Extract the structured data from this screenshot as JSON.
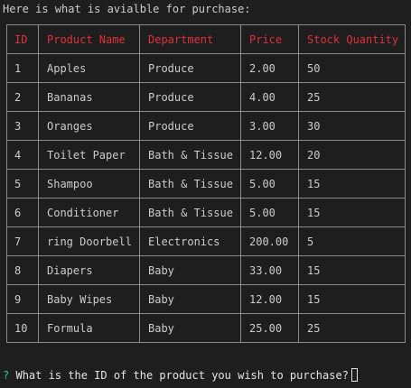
{
  "intro_text": "Here is what is avialble for purchase:",
  "table": {
    "headers": {
      "id": "ID",
      "name": "Product Name",
      "dept": "Department",
      "price": "Price",
      "qty": "Stock Quantity"
    },
    "rows": [
      {
        "id": "1",
        "name": "Apples",
        "dept": "Produce",
        "price": "2.00",
        "qty": "50"
      },
      {
        "id": "2",
        "name": "Bananas",
        "dept": "Produce",
        "price": "4.00",
        "qty": "25"
      },
      {
        "id": "3",
        "name": "Oranges",
        "dept": "Produce",
        "price": "3.00",
        "qty": "30"
      },
      {
        "id": "4",
        "name": "Toilet Paper",
        "dept": "Bath & Tissue",
        "price": "12.00",
        "qty": "20"
      },
      {
        "id": "5",
        "name": "Shampoo",
        "dept": "Bath & Tissue",
        "price": "5.00",
        "qty": "15"
      },
      {
        "id": "6",
        "name": "Conditioner",
        "dept": "Bath & Tissue",
        "price": "5.00",
        "qty": "15"
      },
      {
        "id": "7",
        "name": "ring Doorbell",
        "dept": "Electronics",
        "price": "200.00",
        "qty": "5"
      },
      {
        "id": "8",
        "name": "Diapers",
        "dept": "Baby",
        "price": "33.00",
        "qty": "15"
      },
      {
        "id": "9",
        "name": "Baby Wipes",
        "dept": "Baby",
        "price": "12.00",
        "qty": "15"
      },
      {
        "id": "10",
        "name": "Formula",
        "dept": "Baby",
        "price": "25.00",
        "qty": "25"
      }
    ]
  },
  "prompt": {
    "marker": "?",
    "question": "What is the ID of the product you wish to purchase?"
  },
  "colors": {
    "background": "#1e1e1e",
    "header_text": "#e0313a",
    "prompt_marker": "#23d18b",
    "text": "#cccccc"
  }
}
